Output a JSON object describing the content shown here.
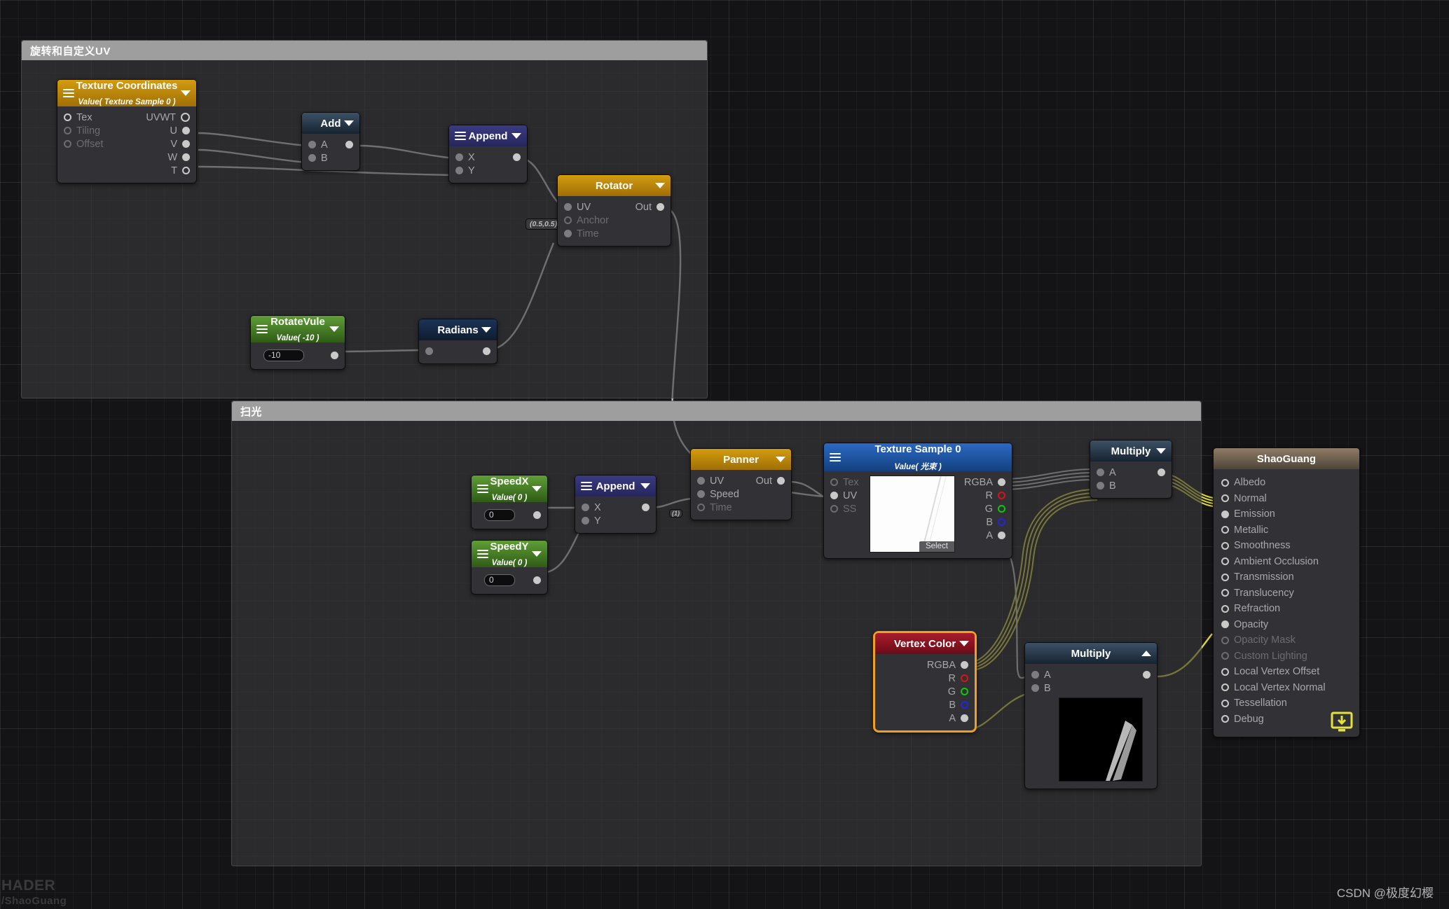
{
  "app": {
    "corner_label_line1": "HADER",
    "corner_label_line2": "/ShaoGuang",
    "watermark": "CSDN @极度幻樱"
  },
  "groups": [
    {
      "title": "旋转和自定义UV"
    },
    {
      "title": "扫光"
    }
  ],
  "nodes": {
    "texture_coordinates": {
      "title": "Texture Coordinates",
      "subtitle": "Value( Texture Sample 0 )",
      "inputs": [
        {
          "label": "Tex",
          "style": "hollow"
        },
        {
          "label": "Tiling",
          "style": "hollow-dim"
        },
        {
          "label": "Offset",
          "style": "hollow-dim"
        }
      ],
      "outputs": [
        {
          "label": "UVWT",
          "style": "hollow"
        },
        {
          "label": "U",
          "style": "filled"
        },
        {
          "label": "V",
          "style": "filled"
        },
        {
          "label": "W",
          "style": "filled"
        },
        {
          "label": "T",
          "style": "hollow"
        }
      ]
    },
    "add": {
      "title": "Add",
      "inputs": [
        {
          "label": "A"
        },
        {
          "label": "B"
        }
      ],
      "outputs": [
        {
          "label": ""
        }
      ]
    },
    "append_uv": {
      "title": "Append",
      "inputs": [
        {
          "label": "X"
        },
        {
          "label": "Y"
        }
      ],
      "outputs": [
        {
          "label": ""
        }
      ]
    },
    "rotator": {
      "title": "Rotator",
      "anchor_chip": "(0.5,0.5)",
      "inputs": [
        {
          "label": "UV",
          "style": "filled"
        },
        {
          "label": "Anchor",
          "style": "hollow-dim"
        },
        {
          "label": "Time",
          "style": "filled"
        }
      ],
      "outputs": [
        {
          "label": "Out",
          "style": "filled"
        }
      ]
    },
    "rotate_vule": {
      "title": "RotateVule",
      "subtitle": "Value( -10 )",
      "value": "-10"
    },
    "radians": {
      "title": "Radians",
      "inputs": [
        {
          "label": ""
        }
      ],
      "outputs": [
        {
          "label": ""
        }
      ]
    },
    "speed_x": {
      "title": "SpeedX",
      "subtitle": "Value( 0 )",
      "value": "0"
    },
    "speed_y": {
      "title": "SpeedY",
      "subtitle": "Value( 0 )",
      "value": "0"
    },
    "append_speed": {
      "title": "Append",
      "inputs": [
        {
          "label": "X"
        },
        {
          "label": "Y"
        }
      ],
      "outputs": [
        {
          "label": ""
        }
      ]
    },
    "panner": {
      "title": "Panner",
      "time_chip": "(1)",
      "inputs": [
        {
          "label": "UV",
          "style": "filled"
        },
        {
          "label": "Speed",
          "style": "filled"
        },
        {
          "label": "Time",
          "style": "hollow-dim"
        }
      ],
      "outputs": [
        {
          "label": "Out",
          "style": "filled"
        }
      ]
    },
    "texture_sample": {
      "title": "Texture Sample 0",
      "subtitle": "Value( 光束 )",
      "select_label": "Select",
      "inputs": [
        {
          "label": "Tex",
          "style": "hollow-dim"
        },
        {
          "label": "UV",
          "style": "filled"
        },
        {
          "label": "SS",
          "style": "hollow-dim"
        }
      ],
      "outputs": [
        {
          "label": "RGBA",
          "style": "filled"
        },
        {
          "label": "R",
          "style": "red"
        },
        {
          "label": "G",
          "style": "green"
        },
        {
          "label": "B",
          "style": "blue"
        },
        {
          "label": "A",
          "style": "filled"
        }
      ]
    },
    "multiply_top": {
      "title": "Multiply",
      "inputs": [
        {
          "label": "A"
        },
        {
          "label": "B"
        }
      ],
      "outputs": [
        {
          "label": ""
        }
      ]
    },
    "vertex_color": {
      "title": "Vertex Color",
      "outputs": [
        {
          "label": "RGBA",
          "style": "filled"
        },
        {
          "label": "R",
          "style": "red"
        },
        {
          "label": "G",
          "style": "green"
        },
        {
          "label": "B",
          "style": "blue"
        },
        {
          "label": "A",
          "style": "filled"
        }
      ]
    },
    "multiply_bottom": {
      "title": "Multiply",
      "inputs": [
        {
          "label": "A"
        },
        {
          "label": "B"
        }
      ],
      "outputs": [
        {
          "label": ""
        }
      ]
    },
    "shao_guang": {
      "title": "ShaoGuang",
      "slots": [
        {
          "label": "Albedo",
          "state": "hollow"
        },
        {
          "label": "Normal",
          "state": "hollow"
        },
        {
          "label": "Emission",
          "state": "filled"
        },
        {
          "label": "Metallic",
          "state": "hollow"
        },
        {
          "label": "Smoothness",
          "state": "hollow"
        },
        {
          "label": "Ambient Occlusion",
          "state": "hollow"
        },
        {
          "label": "Transmission",
          "state": "hollow"
        },
        {
          "label": "Translucency",
          "state": "hollow"
        },
        {
          "label": "Refraction",
          "state": "hollow"
        },
        {
          "label": "Opacity",
          "state": "filled"
        },
        {
          "label": "Opacity Mask",
          "state": "disabled"
        },
        {
          "label": "Custom Lighting",
          "state": "disabled"
        },
        {
          "label": "Local Vertex Offset",
          "state": "hollow"
        },
        {
          "label": "Local Vertex Normal",
          "state": "hollow"
        },
        {
          "label": "Tessellation",
          "state": "hollow"
        },
        {
          "label": "Debug",
          "state": "hollow"
        }
      ]
    }
  },
  "colors": {
    "wire": "#d6d6d6",
    "wire_yellow": "#e6e03a",
    "accent_gold": "#d39c10",
    "accent_green": "#5f9e36",
    "accent_red": "#a81b2c",
    "selection": "#f0a020"
  }
}
